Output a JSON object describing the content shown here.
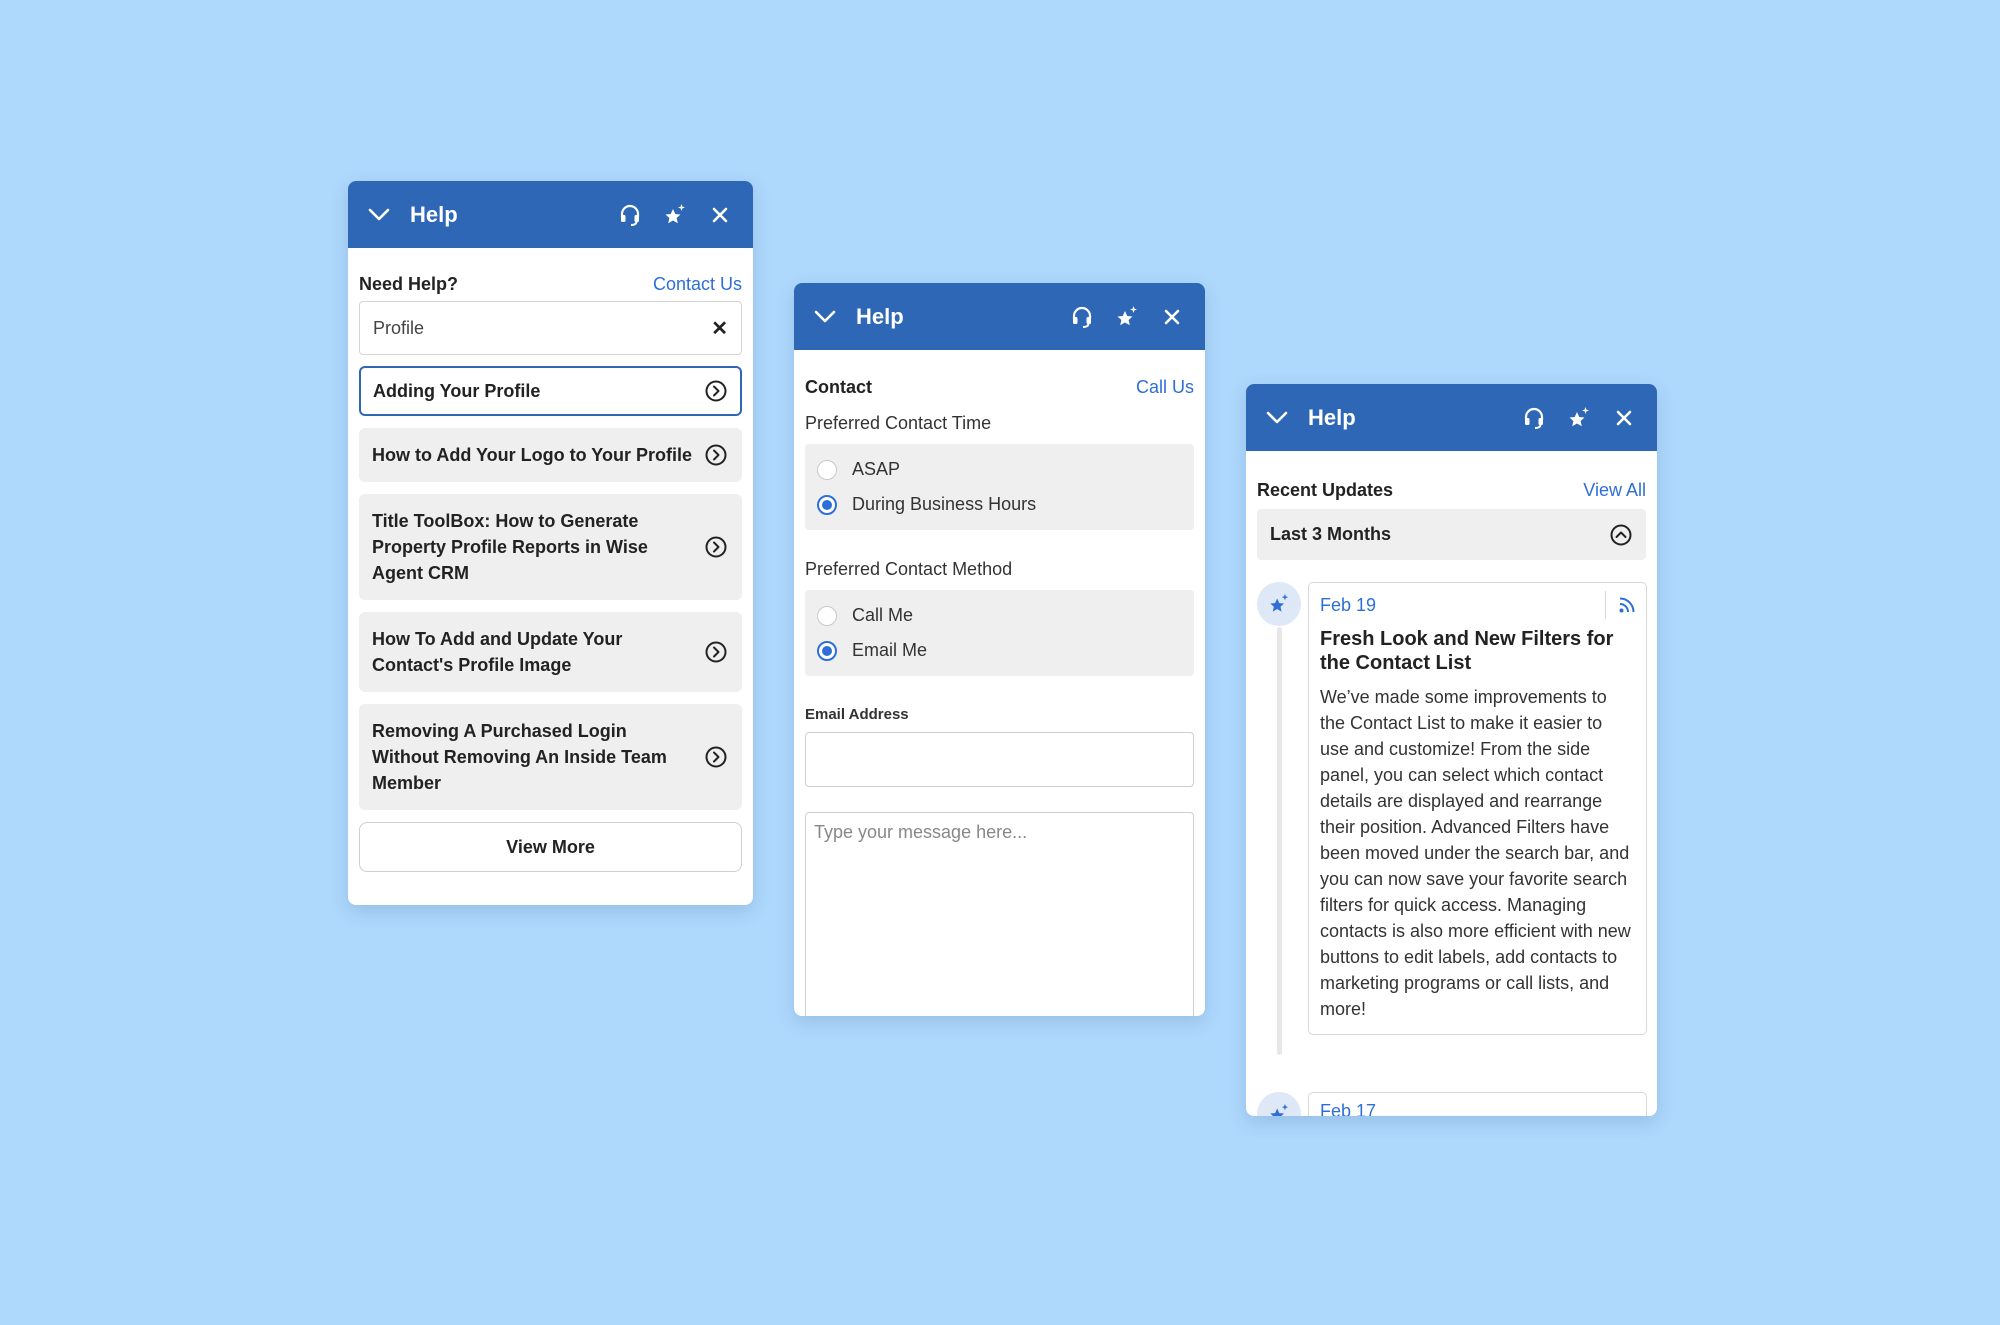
{
  "colors": {
    "header": "#2f67b7",
    "accent": "#2d6fd6",
    "background": "#aed8fc"
  },
  "icons": {
    "collapse": "chevron-down-icon",
    "support": "headset-icon",
    "whats_new": "sparkle-star-icon",
    "close": "close-icon",
    "open_article": "arrow-circle-right-icon",
    "collapse_filter": "chevron-up-circle-icon",
    "rss": "rss-icon"
  },
  "search_panel": {
    "title": "Help",
    "need_help_label": "Need Help?",
    "contact_link": "Contact Us",
    "search_value": "Profile",
    "clear_label": "✕",
    "articles": [
      {
        "title": "Adding Your Profile"
      },
      {
        "title": "How to Add Your Logo to Your Profile"
      },
      {
        "title": "Title ToolBox: How to Generate Property Profile Reports in Wise Agent CRM"
      },
      {
        "title": "How To Add and Update Your Contact's Profile Image"
      },
      {
        "title": "Removing A Purchased Login Without Removing An Inside Team Member"
      }
    ],
    "view_more_label": "View More"
  },
  "contact_panel": {
    "title": "Help",
    "section_label": "Contact",
    "call_link": "Call Us",
    "time_label": "Preferred Contact Time",
    "time_options": [
      {
        "label": "ASAP",
        "selected": false
      },
      {
        "label": "During Business Hours",
        "selected": true
      }
    ],
    "method_label": "Preferred Contact Method",
    "method_options": [
      {
        "label": "Call Me",
        "selected": false
      },
      {
        "label": "Email Me",
        "selected": true
      }
    ],
    "email_label": "Email Address",
    "email_value": "",
    "message_placeholder": "Type your message here..."
  },
  "updates_panel": {
    "title": "Help",
    "section_label": "Recent Updates",
    "view_all_link": "View All",
    "filter_label": "Last 3 Months",
    "updates": [
      {
        "date": "Feb 19",
        "title": "Fresh Look and New Filters for the Contact List",
        "body": "We’ve made some improvements to the Contact List to make it easier to use and customize! From the side panel, you can select which contact details are displayed and rearrange their position. Advanced Filters have been moved under the search bar, and you can now save your favorite search filters for quick access. Managing contacts is also more efficient with new buttons to edit labels, add contacts to marketing programs or call lists, and more!"
      },
      {
        "date": "Feb 17"
      }
    ]
  }
}
